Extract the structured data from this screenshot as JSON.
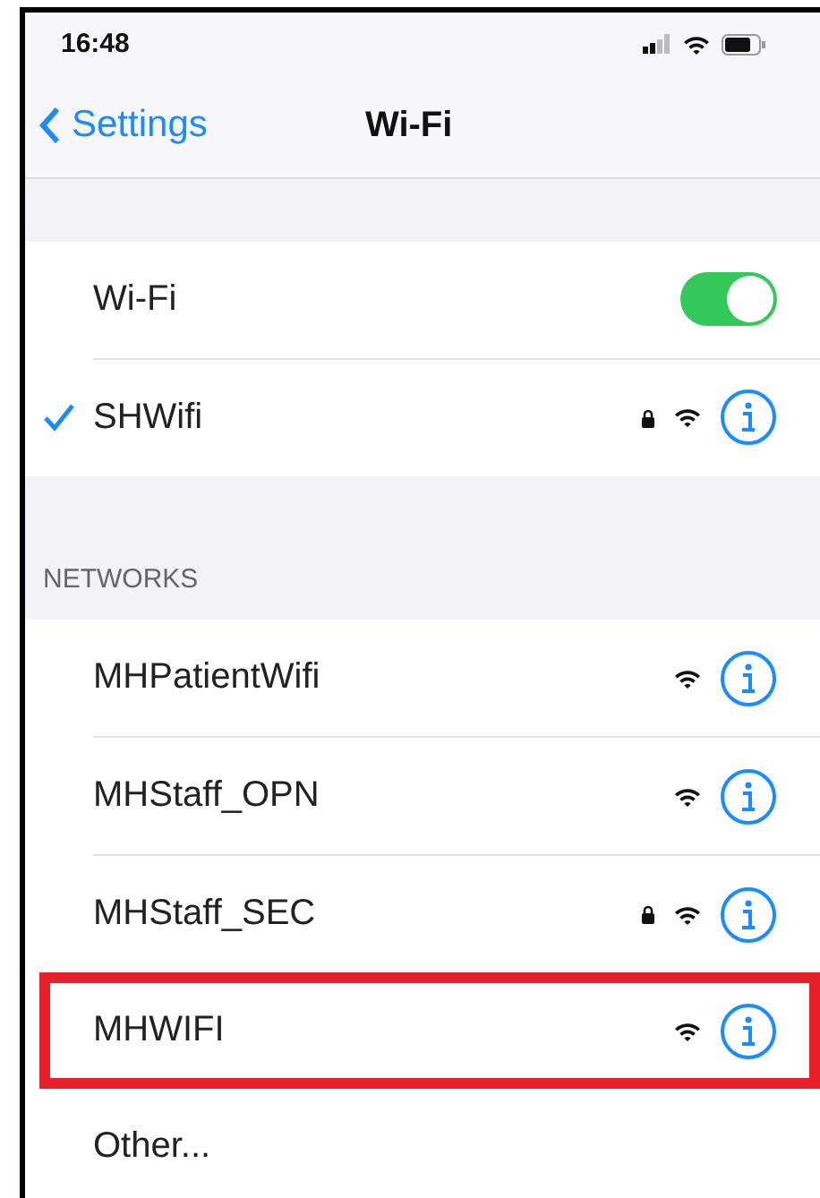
{
  "status_bar": {
    "time": "16:48"
  },
  "nav": {
    "back": "Settings",
    "title": "Wi-Fi"
  },
  "wifi_toggle": {
    "label": "Wi-Fi",
    "on": true
  },
  "connected": {
    "name": "SHWifi",
    "checked": true,
    "locked": true
  },
  "networks_header": "NETWORKS",
  "networks": [
    {
      "name": "MHPatientWifi",
      "locked": false,
      "highlighted": false
    },
    {
      "name": "MHStaff_OPN",
      "locked": false,
      "highlighted": false
    },
    {
      "name": "MHStaff_SEC",
      "locked": true,
      "highlighted": false
    },
    {
      "name": "MHWIFI",
      "locked": false,
      "highlighted": true
    }
  ],
  "other": "Other..."
}
